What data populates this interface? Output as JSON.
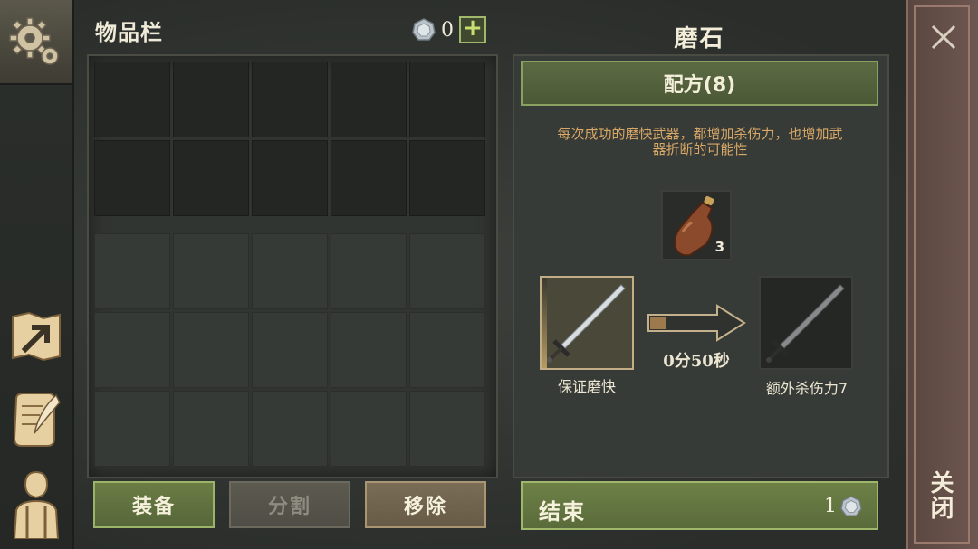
{
  "inventory": {
    "title": "物品栏",
    "coins": "0",
    "plus_label": "+",
    "buttons": {
      "equip": "装备",
      "split": "分割",
      "remove": "移除"
    }
  },
  "craft": {
    "title": "磨石",
    "recipe_label": "配方(8)",
    "description_line1": "每次成功的磨快武器，都增加杀伤力，也增加武",
    "description_line2": "器折断的可能性",
    "material_count": "3",
    "input_label": "保证磨快",
    "timer": "0分50秒",
    "output_label": "额外杀伤力7",
    "end_label": "结束",
    "end_cost": "1"
  },
  "close": {
    "label": "关闭"
  },
  "colors": {
    "accent_green": "#6d8146",
    "desc_orange": "#d9a867",
    "close_red": "#6e5750"
  }
}
